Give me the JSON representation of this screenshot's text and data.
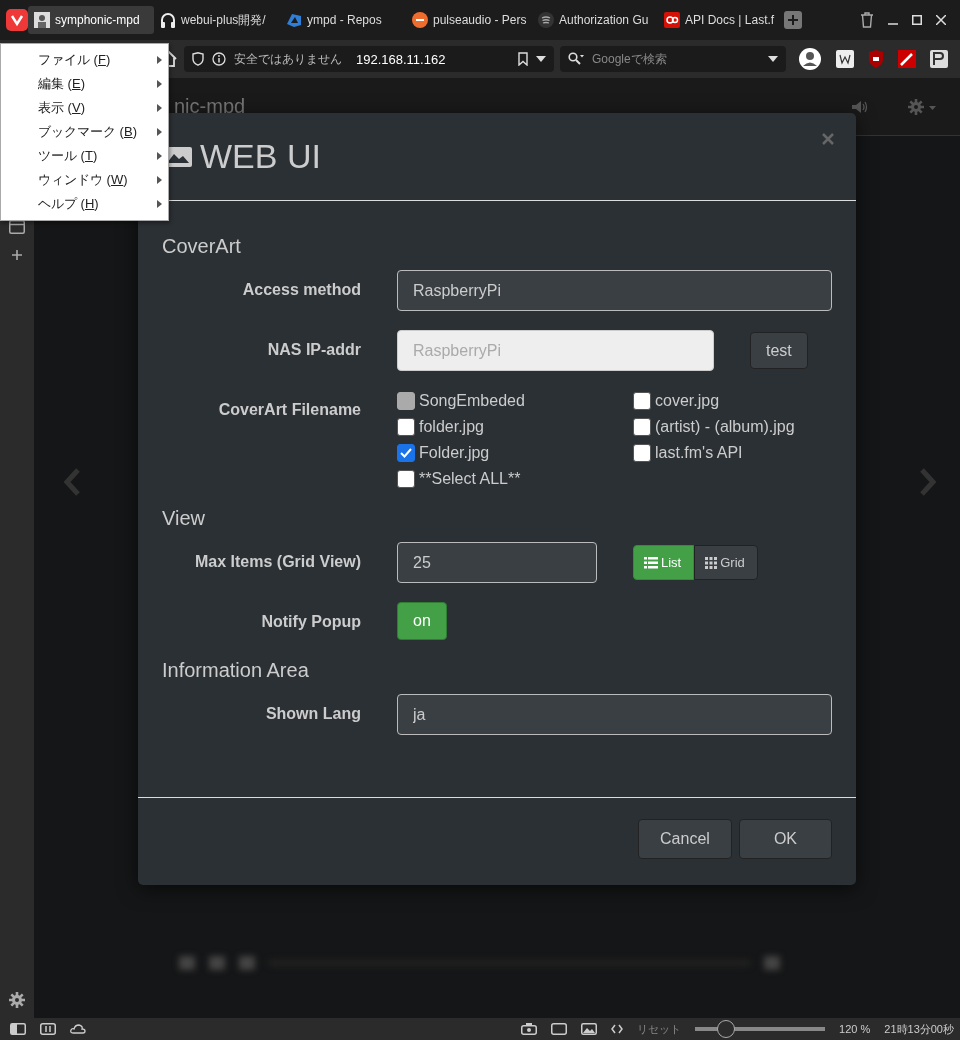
{
  "browser": {
    "tabs": [
      {
        "label": "symphonic-mpd",
        "selected": true,
        "kind": "photo"
      },
      {
        "label": "webui-plus開発/",
        "selected": false,
        "kind": "headphones"
      },
      {
        "label": "ympd - Repos",
        "selected": false,
        "kind": "cloud"
      },
      {
        "label": "pulseaudio - Pers",
        "selected": false,
        "kind": "ask"
      },
      {
        "label": "Authorization Gu",
        "selected": false,
        "kind": "spotify"
      },
      {
        "label": "API Docs | Last.f",
        "selected": false,
        "kind": "lastfm"
      }
    ],
    "address": {
      "security": "安全ではありません",
      "url": "192.168.11.162"
    },
    "search": {
      "placeholder": "Googleで検索"
    },
    "menu": [
      {
        "prefix": "ファイル (",
        "key": "F",
        "suffix": ")"
      },
      {
        "prefix": "編集 (",
        "key": "E",
        "suffix": ")"
      },
      {
        "prefix": "表示 (",
        "key": "V",
        "suffix": ")"
      },
      {
        "prefix": "ブックマーク (",
        "key": "B",
        "suffix": ")"
      },
      {
        "prefix": "ツール (",
        "key": "T",
        "suffix": ")"
      },
      {
        "prefix": "ウィンドウ (",
        "key": "W",
        "suffix": ")"
      },
      {
        "prefix": "ヘルプ (",
        "key": "H",
        "suffix": ")"
      }
    ]
  },
  "page": {
    "brand": "nic-mpd"
  },
  "dialog": {
    "title": "WEB UI",
    "sections": [
      {
        "heading": "CoverArt",
        "rows": [
          {
            "kind": "input",
            "label": "Access method",
            "value": "RaspberryPi",
            "disabled": false
          },
          {
            "kind": "input_button",
            "label": "NAS IP-addr",
            "value": "RaspberryPi",
            "disabled": true,
            "button": "test"
          },
          {
            "kind": "checkboxes",
            "label": "CoverArt Filename",
            "options": [
              {
                "label": "SongEmbeded",
                "checked": false,
                "disabled": true
              },
              {
                "label": "cover.jpg",
                "checked": false,
                "disabled": false
              },
              {
                "label": "folder.jpg",
                "checked": false,
                "disabled": false
              },
              {
                "label": "(artist) - (album).jpg",
                "checked": false,
                "disabled": false
              },
              {
                "label": "Folder.jpg",
                "checked": true,
                "disabled": false
              },
              {
                "label": "last.fm's API",
                "checked": false,
                "disabled": false
              },
              {
                "label": "**Select ALL**",
                "checked": false,
                "disabled": false
              }
            ]
          }
        ]
      },
      {
        "heading": "View",
        "rows": [
          {
            "kind": "input_group",
            "label": "Max Items (Grid View)",
            "value": "25",
            "disabled": false,
            "options": [
              {
                "label": "List",
                "kind": "list",
                "selected": true
              },
              {
                "label": "Grid",
                "kind": "grid",
                "selected": false
              }
            ]
          },
          {
            "kind": "toggle",
            "label": "Notify Popup",
            "button": "on",
            "on": true
          }
        ]
      },
      {
        "heading": "Information Area",
        "rows": [
          {
            "kind": "input",
            "label": "Shown Lang",
            "value": "ja",
            "disabled": false
          }
        ]
      }
    ],
    "buttons": [
      "Cancel",
      "OK"
    ]
  },
  "status_bar": {
    "reset": "リセット",
    "zoom_slider": {
      "level": 0.24
    },
    "zoom": "120 %",
    "clock": "21時13分00秒"
  }
}
